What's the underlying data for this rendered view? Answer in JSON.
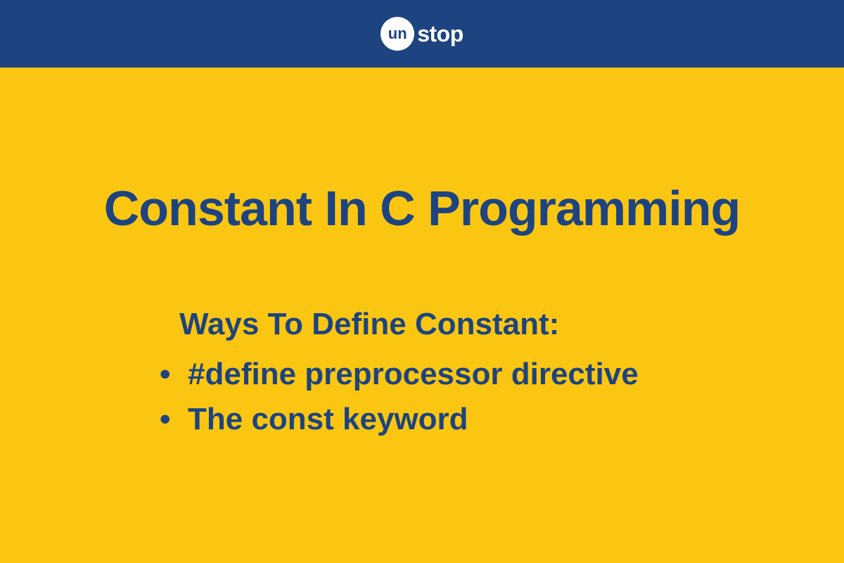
{
  "logo": {
    "prefix": "un",
    "suffix": "stop"
  },
  "title": "Constant In C Programming",
  "subtitle": "Ways To Define  Constant:",
  "items": [
    "#define preprocessor directive",
    "The const keyword"
  ]
}
